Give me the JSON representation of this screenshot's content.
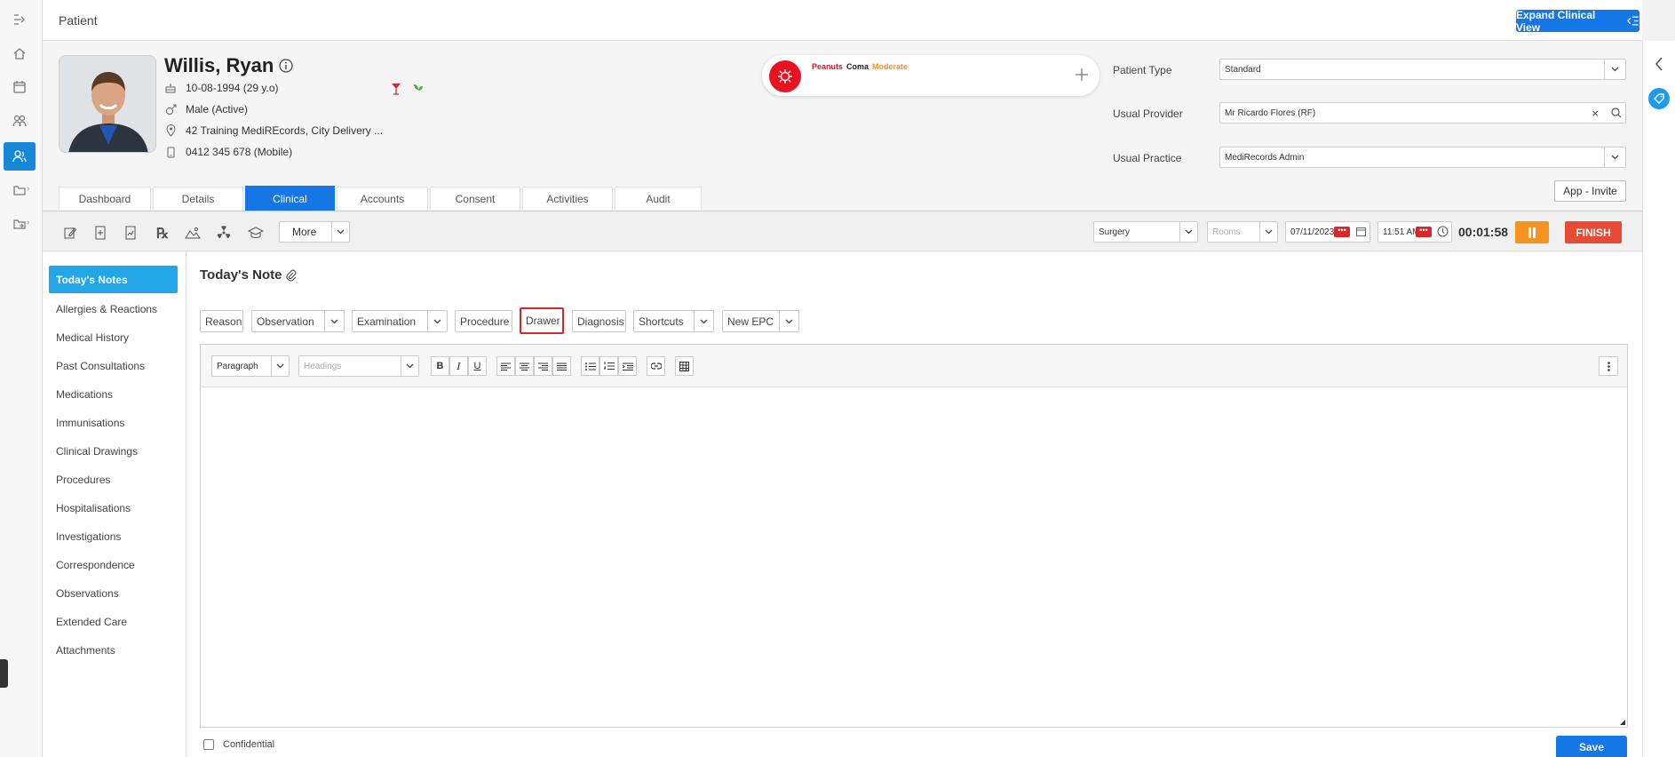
{
  "header": {
    "title": "Patient",
    "expand_button": "Expand Clinical View"
  },
  "patient": {
    "name": "Willis, Ryan",
    "dob": "10-08-1994 (29 y.o)",
    "gender": "Male (Active)",
    "address": "42 Training MediREcords, City Delivery ...",
    "phone": "0412 345 678 (Mobile)"
  },
  "allergy": {
    "item1": "Peanuts",
    "item2": "Coma",
    "severity": "Moderate"
  },
  "fields": {
    "patient_type_label": "Patient Type",
    "patient_type_value": "Standard",
    "usual_provider_label": "Usual Provider",
    "usual_provider_value": "Mr Ricardo Flores (RF)",
    "usual_practice_label": "Usual Practice",
    "usual_practice_value": "MediRecords Admin",
    "app_invite": "App - Invite"
  },
  "tabs": [
    "Dashboard",
    "Details",
    "Clinical",
    "Accounts",
    "Consent",
    "Activities",
    "Audit"
  ],
  "toolbar": {
    "more": "More",
    "surgery": "Surgery",
    "rooms": "Rooms",
    "date": "07/11/2023",
    "time": "11:51 AM",
    "timer": "00:01:58",
    "finish": "FINISH"
  },
  "sidemenu": [
    "Today's Notes",
    "Allergies & Reactions",
    "Medical History",
    "Past Consultations",
    "Medications",
    "Immunisations",
    "Clinical Drawings",
    "Procedures",
    "Hospitalisations",
    "Investigations",
    "Correspondence",
    "Observations",
    "Extended Care",
    "Attachments"
  ],
  "note": {
    "title": "Today's Note",
    "buttons": {
      "reason": "Reason",
      "observation": "Observation",
      "examination": "Examination",
      "procedure": "Procedure",
      "drawer": "Drawer",
      "diagnosis": "Diagnosis",
      "shortcuts": "Shortcuts",
      "new_epc": "New EPC"
    },
    "paragraph": "Paragraph",
    "headings": "Headings",
    "confidential": "Confidential",
    "save": "Save"
  },
  "colors": {
    "primary": "#1577e6",
    "active_menu": "#22a6e8",
    "finish": "#e84a36",
    "pause": "#f7931e",
    "highlight": "#d9262b"
  }
}
